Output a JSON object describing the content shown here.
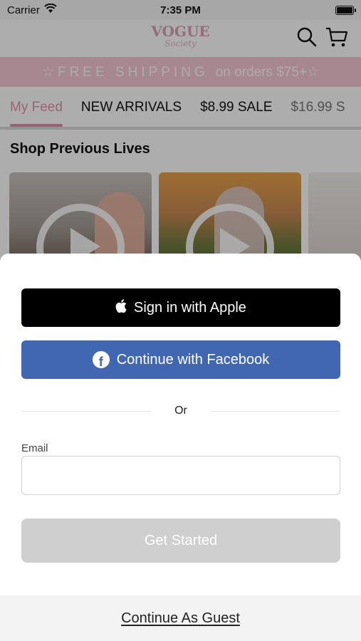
{
  "status_bar": {
    "carrier": "Carrier",
    "time": "7:35 PM"
  },
  "header": {
    "logo_main": "VOGUE",
    "logo_sub": "Society"
  },
  "banner": {
    "spaced": "☆FREE SHIPPING",
    "rest": "on orders $75+☆"
  },
  "tabs": [
    {
      "label": "My Feed"
    },
    {
      "label": "NEW ARRIVALS"
    },
    {
      "label": "$8.99 SALE"
    },
    {
      "label": "$16.99 S"
    }
  ],
  "section": {
    "title": "Shop Previous Lives"
  },
  "sheet": {
    "apple_label": "Sign in with Apple",
    "facebook_label": "Continue with Facebook",
    "divider": "Or",
    "email_label": "Email",
    "email_value": "",
    "get_started_label": "Get Started",
    "guest_label": "Continue As Guest"
  },
  "colors": {
    "facebook": "#4267b2",
    "banner": "#f7c8d4",
    "accent_pink": "#e292a8",
    "disabled_button": "#cfcfcf"
  },
  "icons": [
    "wifi-icon",
    "battery-icon",
    "search-icon",
    "cart-icon",
    "play-icon",
    "apple-icon",
    "facebook-icon"
  ]
}
